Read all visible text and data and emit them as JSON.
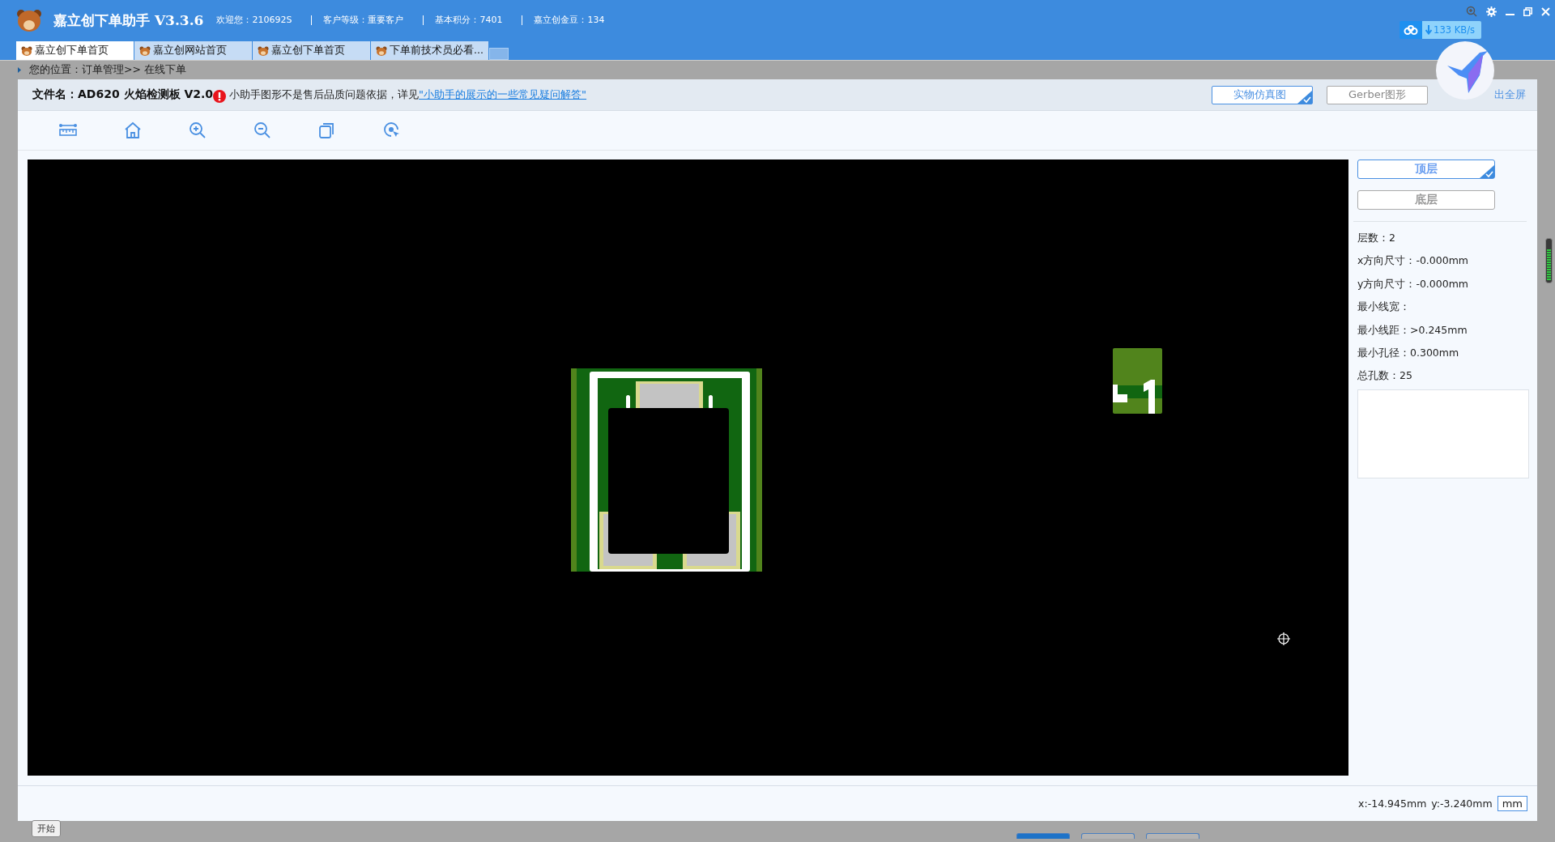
{
  "app": {
    "title": "嘉立创下单助手 V3.3.6",
    "info": [
      "欢迎您：210692S",
      "客户等级：重要客户",
      "基本积分：7401",
      "嘉立创金豆：134"
    ],
    "download_speed": "133 KB/s"
  },
  "tabs": [
    {
      "label": "嘉立创下单首页",
      "selected": true
    },
    {
      "label": "嘉立创网站首页",
      "selected": false
    },
    {
      "label": "嘉立创下单首页",
      "selected": false
    },
    {
      "label": "下单前技术员必看...",
      "selected": false
    }
  ],
  "breadcrumb": "您的位置：订单管理>> 在线下单",
  "viewer": {
    "file_label": "文件名：AD620 火焰检测板 V2.0",
    "notice": "小助手图形不是售后品质问题依据，详见",
    "notice_link": "\"小助手的展示的一些常见疑问解答\"",
    "view_modes": [
      {
        "label": "实物仿真图",
        "selected": true
      },
      {
        "label": "Gerber图形",
        "selected": false
      }
    ],
    "exit_fullscreen": "出全屏",
    "layers": [
      {
        "label": "顶层",
        "selected": true
      },
      {
        "label": "底层",
        "selected": false
      }
    ],
    "properties": [
      "层数：2",
      "x方向尺寸：-0.000mm",
      "y方向尺寸：-0.000mm",
      "最小线宽：",
      "最小线距：>0.245mm",
      "最小孔径：0.300mm",
      "总孔数：25"
    ],
    "cursor_x": "x:-14.945mm",
    "cursor_y": "y:-3.240mm",
    "unit": "mm"
  },
  "start_button": "开始",
  "bottom_buttons": [
    {
      "selected": true
    },
    {
      "selected": false
    },
    {
      "selected": false
    }
  ]
}
